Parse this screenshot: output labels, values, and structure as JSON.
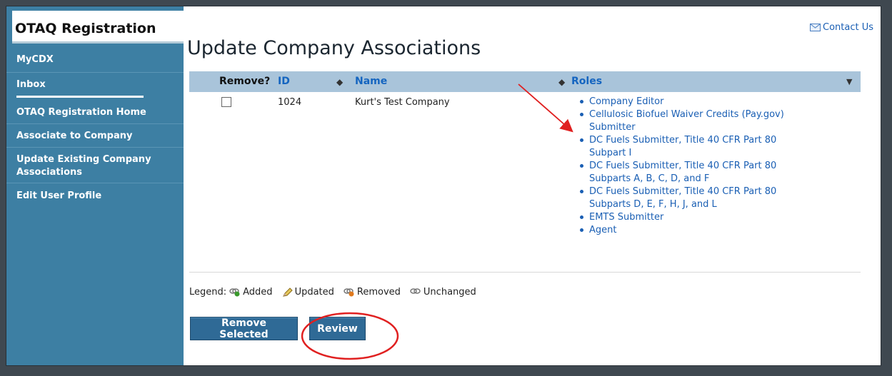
{
  "sidebar": {
    "app_title": "OTAQ Registration",
    "items": [
      {
        "label": "MyCDX"
      },
      {
        "label": "Inbox"
      },
      {
        "label": "OTAQ Registration Home"
      },
      {
        "label": "Associate to Company"
      },
      {
        "label": "Update Existing Company Associations"
      },
      {
        "label": "Edit User Profile"
      }
    ]
  },
  "header": {
    "contact_label": "Contact Us"
  },
  "main": {
    "title": "Update Company Associations",
    "table": {
      "columns": {
        "remove": "Remove?",
        "id": "ID",
        "name": "Name",
        "roles": "Roles"
      },
      "rows": [
        {
          "id": "1024",
          "name": "Kurt's Test Company",
          "roles": [
            "Company Editor",
            "Cellulosic Biofuel Waiver Credits (Pay.gov) Submitter",
            "DC Fuels Submitter, Title 40 CFR Part 80 Subpart I",
            "DC Fuels Submitter, Title 40 CFR Part 80 Subparts A, B, C, D, and F",
            "DC Fuels Submitter, Title 40 CFR Part 80 Subparts D, E, F, H, J, and L",
            "EMTS Submitter",
            "Agent"
          ]
        }
      ]
    },
    "legend": {
      "prefix": "Legend:",
      "added": "Added",
      "updated": "Updated",
      "removed": "Removed",
      "unchanged": "Unchanged"
    },
    "buttons": {
      "remove_selected": "Remove Selected",
      "review": "Review"
    }
  },
  "colors": {
    "sidebar_bg": "#3d7fa3",
    "header_row_bg": "#a9c4da",
    "link": "#1a5fb4",
    "button_bg": "#2f6a96",
    "annotation": "#e02020"
  },
  "icons": [
    "envelope-icon",
    "sort-icon",
    "dropdown-menu-icon",
    "link-added-icon",
    "pencil-updated-icon",
    "link-removed-icon",
    "link-unchanged-icon"
  ]
}
